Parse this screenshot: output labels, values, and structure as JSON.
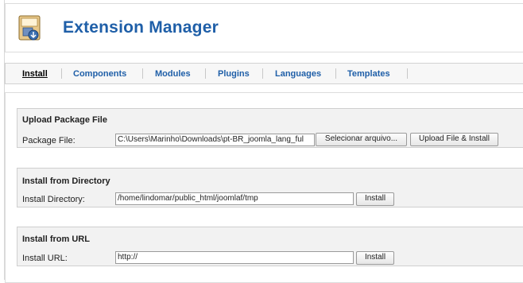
{
  "header": {
    "title": "Extension Manager",
    "icon": "package-install-icon"
  },
  "tabs": [
    {
      "label": "Install",
      "active": true
    },
    {
      "label": "Components"
    },
    {
      "label": "Modules"
    },
    {
      "label": "Plugins"
    },
    {
      "label": "Languages"
    },
    {
      "label": "Templates"
    }
  ],
  "upload": {
    "title": "Upload Package File",
    "label": "Package File:",
    "file_value": "C:\\Users\\Marinho\\Downloads\\pt-BR_joomla_lang_ful",
    "browse_label": "Selecionar arquivo...",
    "submit_label": "Upload File & Install"
  },
  "directory": {
    "title": "Install from Directory",
    "label": "Install Directory:",
    "value": "/home/lindomar/public_html/joomlaf/tmp",
    "submit_label": "Install"
  },
  "url": {
    "title": "Install from URL",
    "label": "Install URL:",
    "value": "http://",
    "submit_label": "Install"
  },
  "colors": {
    "title_blue": "#1f5fa8",
    "panel_gray": "#f2f2f2"
  }
}
